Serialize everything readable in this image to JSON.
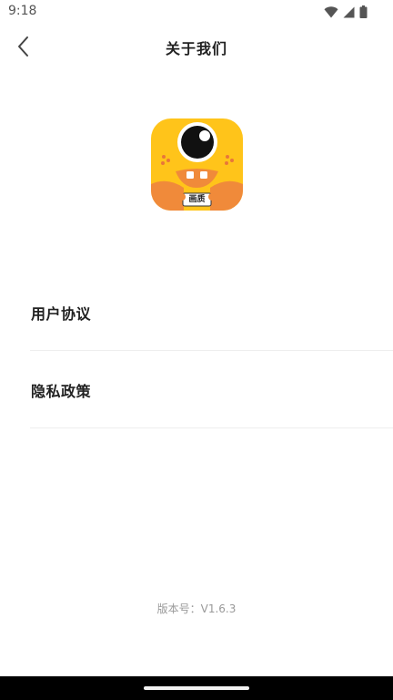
{
  "status_bar": {
    "time": "9:18",
    "icons": [
      "wifi-icon",
      "signal-icon",
      "battery-icon"
    ]
  },
  "header": {
    "title": "关于我们",
    "back_icon": "chevron-left-icon"
  },
  "logo": {
    "label": "画质",
    "colors": {
      "background": "#FFC41A",
      "accent": "#F08A3A",
      "eye": "#111111"
    }
  },
  "menu": {
    "items": [
      {
        "label": "用户协议"
      },
      {
        "label": "隐私政策"
      }
    ]
  },
  "footer": {
    "version": "版本号：V1.6.3"
  },
  "colors": {
    "text_primary": "#222222",
    "text_secondary": "#999999",
    "divider": "#EEEEEE",
    "nav_bar": "#000000"
  }
}
